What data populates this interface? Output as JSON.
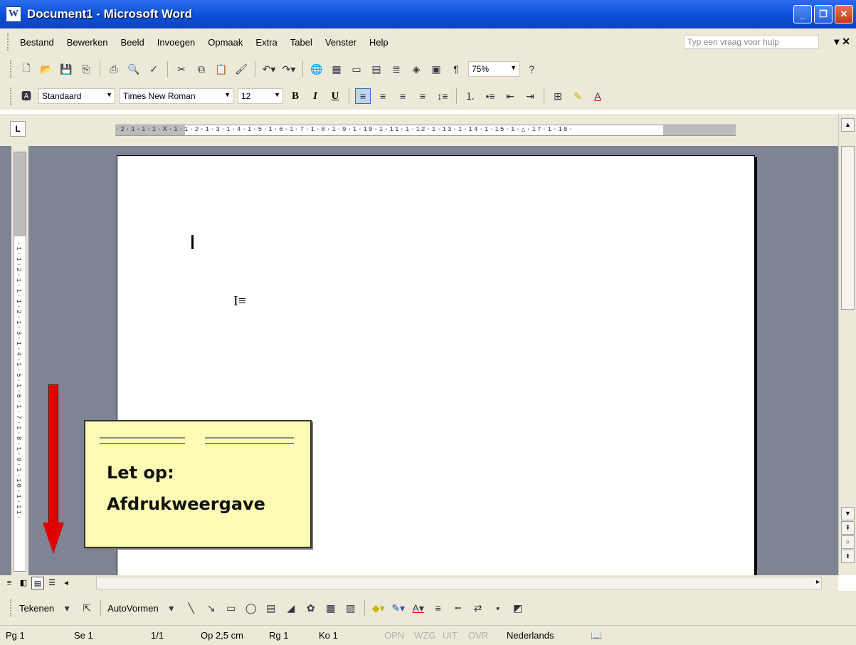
{
  "window": {
    "title": "Document1 - Microsoft Word"
  },
  "menu": {
    "items": [
      "Bestand",
      "Bewerken",
      "Beeld",
      "Invoegen",
      "Opmaak",
      "Extra",
      "Tabel",
      "Venster",
      "Help"
    ],
    "ask_placeholder": "Typ een vraag voor hulp"
  },
  "formatting": {
    "style": "Standaard",
    "font": "Times New Roman",
    "size": "12",
    "bold": "B",
    "italic": "I",
    "underline": "U"
  },
  "standard": {
    "zoom": "75%"
  },
  "ruler": {
    "horizontal": "·2·1·1·1·Ⅹ·1·1·2·1·3·1·4·1·5·1·6·1·7·1·8·1·9·1·10·1·11·1·12·1·13·1·14·1·15·1·△·17·1·18·",
    "vertical": "·1·1·2·1·1·1·2·1·3·1·4·1·5·1·6·1·7·1·8·1·9·1·10·1·11·"
  },
  "drawing": {
    "draw_label": "Tekenen",
    "autoshapes_label": "AutoVormen"
  },
  "status": {
    "page": "Pg 1",
    "section": "Se 1",
    "pages": "1/1",
    "position": "Op 2,5 cm",
    "line": "Rg 1",
    "column": "Ko 1",
    "rec": "OPN",
    "track": "WZG",
    "ext": "UIT",
    "ovr": "OVR",
    "language": "Nederlands"
  },
  "callout": {
    "line1": "Let op:",
    "line2": "Afdrukweergave"
  },
  "colors": {
    "titlebar": "#0a4fd6",
    "chrome": "#ece9d8",
    "workspace": "#7e8493",
    "note": "#fdfcb4",
    "arrow": "#e00000"
  }
}
